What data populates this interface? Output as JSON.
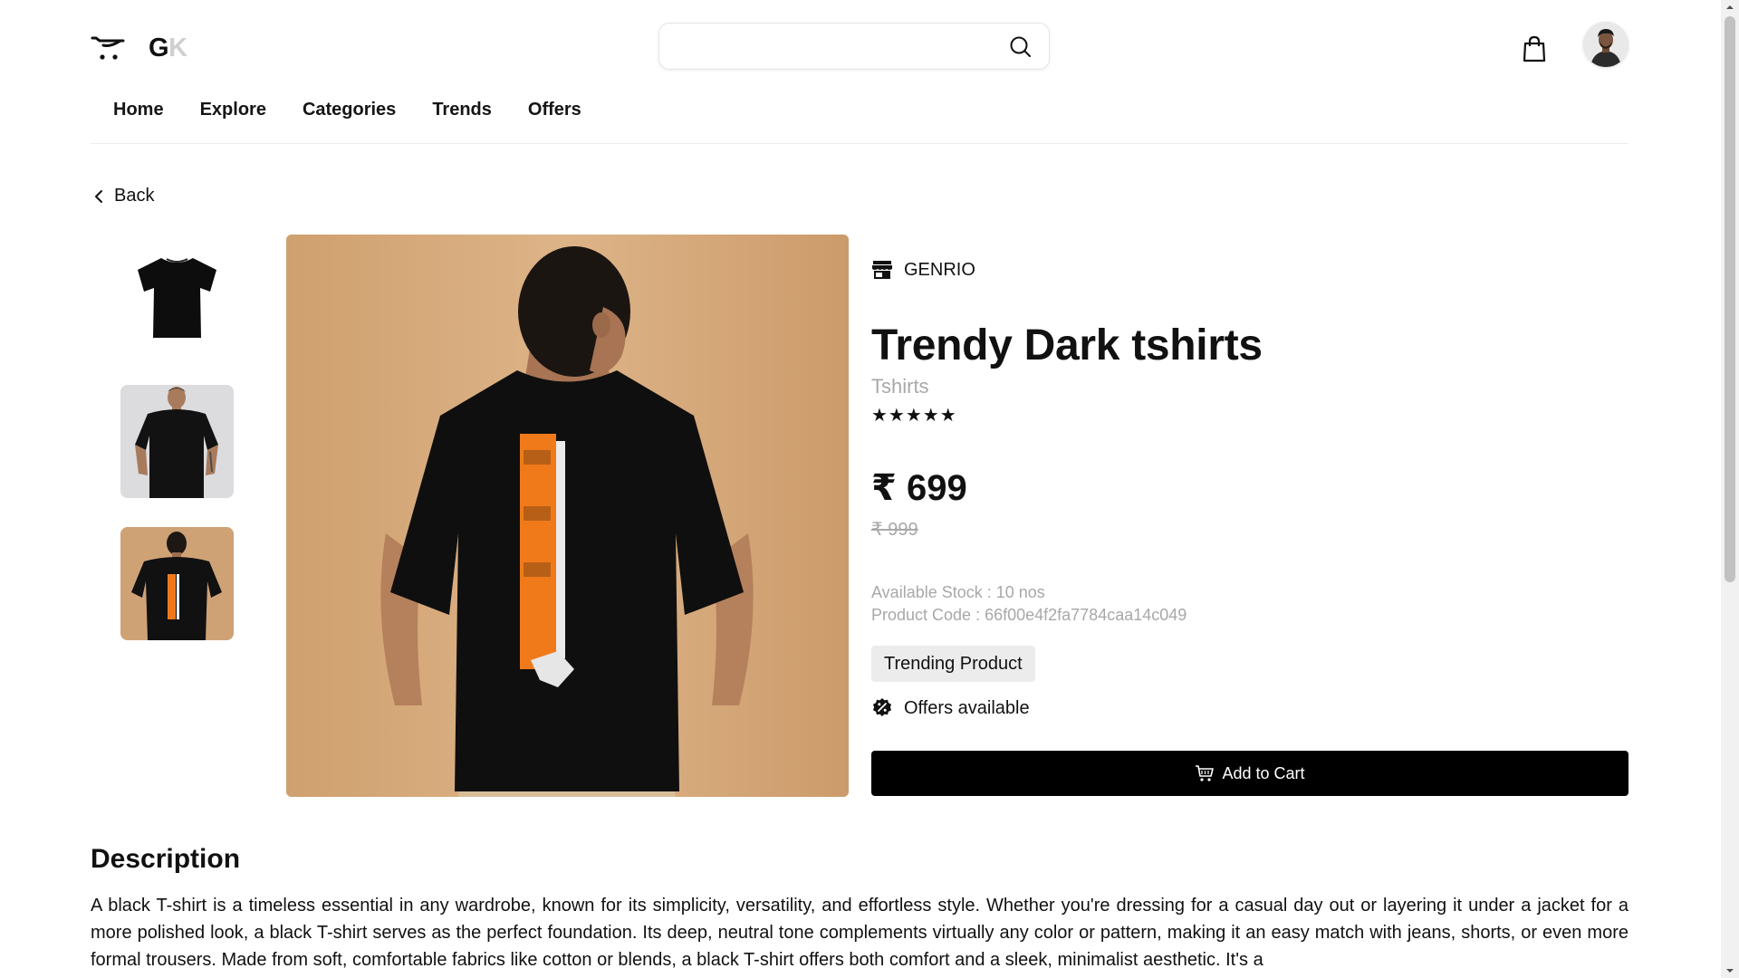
{
  "header": {
    "logo_text": "G",
    "logo_text_faded": "K",
    "search": {
      "value": "",
      "placeholder": ""
    }
  },
  "nav": [
    {
      "label": "Home"
    },
    {
      "label": "Explore"
    },
    {
      "label": "Categories"
    },
    {
      "label": "Trends"
    },
    {
      "label": "Offers"
    }
  ],
  "back_label": "Back",
  "gallery": {
    "thumbnails": [
      "tshirt-flat-front",
      "model-front",
      "model-back"
    ],
    "main_image": "model-back-raw-print"
  },
  "product": {
    "brand": "GENRIO",
    "title": "Trendy Dark tshirts",
    "category": "Tshirts",
    "stars": "★★★★★",
    "rating": 5,
    "price": "₹ 699",
    "mrp": "₹ 999",
    "stock": "Available Stock : 10 nos",
    "code": "Product Code : 66f00e4f2fa7784caa14c049",
    "tag": "Trending Product",
    "offers": "Offers available",
    "add_to_cart": "Add to Cart"
  },
  "description": {
    "title": "Description",
    "body": "A black T-shirt is a timeless essential in any wardrobe, known for its simplicity, versatility, and effortless style. Whether you're dressing for a casual day out or layering it under a jacket for a more polished look, a black T-shirt serves as the perfect foundation. Its deep, neutral tone complements virtually any color or pattern, making it an easy match with jeans, shorts, or even more formal trousers. Made from soft, comfortable fabrics like cotton or blends, a black T-shirt offers both comfort and a sleek, minimalist aesthetic. It's a"
  },
  "icons": {
    "logo": "cart-logo-icon",
    "search": "search-icon",
    "bag": "shopping-bag-icon",
    "back": "chevron-left-icon",
    "brand": "store-icon",
    "offers": "discount-badge-icon",
    "cart": "cart-icon"
  },
  "colors": {
    "primary": "#000000",
    "muted_text": "#a8a8a8",
    "tag_bg": "#ececec",
    "print_orange": "#f07a1a"
  }
}
